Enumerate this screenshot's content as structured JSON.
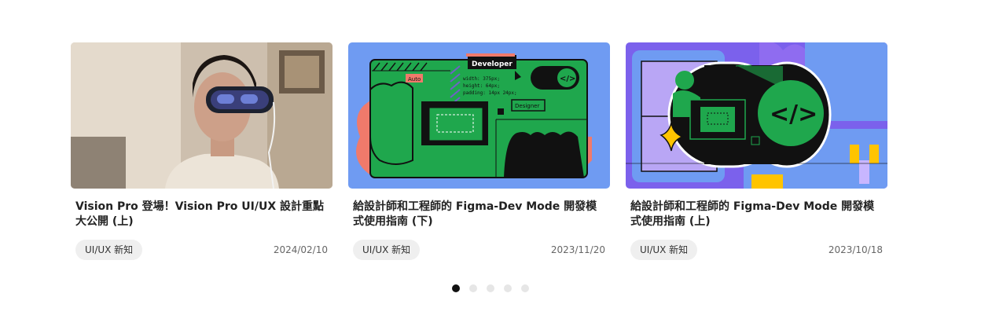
{
  "cards": [
    {
      "title": "Vision Pro 登場！Vision Pro UI/UX 設計重點大公開 (上)",
      "tag": "UI/UX 新知",
      "date": "2024/02/10"
    },
    {
      "title": "給設計師和工程師的 Figma-Dev Mode 開發模式使用指南 (下)",
      "tag": "UI/UX 新知",
      "date": "2023/11/20",
      "illustration": {
        "label_developer": "Developer",
        "label_designer": "Designer",
        "label_auto": "Auto",
        "spec_line1": "width: 375px;",
        "spec_line2": "height: 64px;",
        "spec_line3": "padding: 14px 24px;",
        "code_icon": "</>"
      }
    },
    {
      "title": "給設計師和工程師的 Figma-Dev Mode 開發模式使用指南 (上)",
      "tag": "UI/UX 新知",
      "date": "2023/10/18",
      "illustration": {
        "code_icon": "</>"
      }
    }
  ],
  "pagination": {
    "count": 5,
    "active": 0
  },
  "colors": {
    "blue_bg": "#6f9bf2",
    "green": "#1fa74d",
    "salmon": "#f07a6b",
    "purple": "#8f6cf0",
    "active_dot": "#111111"
  }
}
